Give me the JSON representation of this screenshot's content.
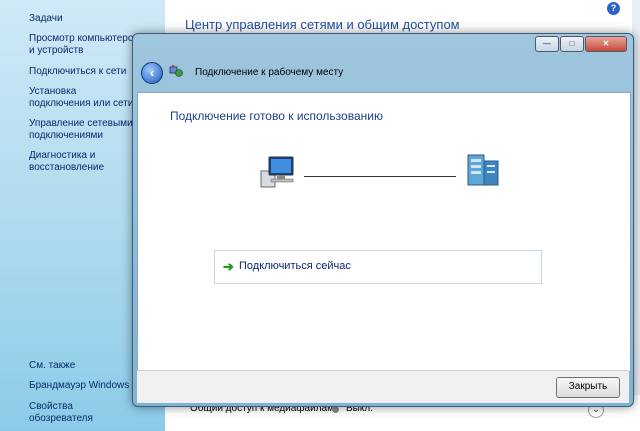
{
  "background_window": {
    "title": "Центр управления сетями и общим доступом",
    "help_label": "?",
    "sidebar": {
      "tasks_header": "Задачи",
      "items": [
        "Просмотр компьютеров и устройств",
        "Подключиться к сети",
        "Установка подключения или сети",
        "Управление сетевыми подключениями",
        "Диагностика и восстановление"
      ],
      "see_also_header": "См. также",
      "see_also_items": [
        "Брандмауэр Windows",
        "Свойства обозревателя"
      ]
    },
    "bottom_row": {
      "label": "Общий доступ к медиафайлам",
      "value": "Выкл."
    }
  },
  "dialog": {
    "caption_buttons": {
      "minimize": "—",
      "maximize": "□",
      "close": "✕"
    },
    "wizard_title": "Подключение к рабочему месту",
    "heading": "Подключение готово к использованию",
    "connect_now_label": "Подключиться сейчас",
    "close_button_label": "Закрыть"
  },
  "icons": [
    "back-arrow-icon",
    "network-wizard-icon",
    "computer-icon",
    "server-icon",
    "green-arrow-icon",
    "help-icon"
  ]
}
